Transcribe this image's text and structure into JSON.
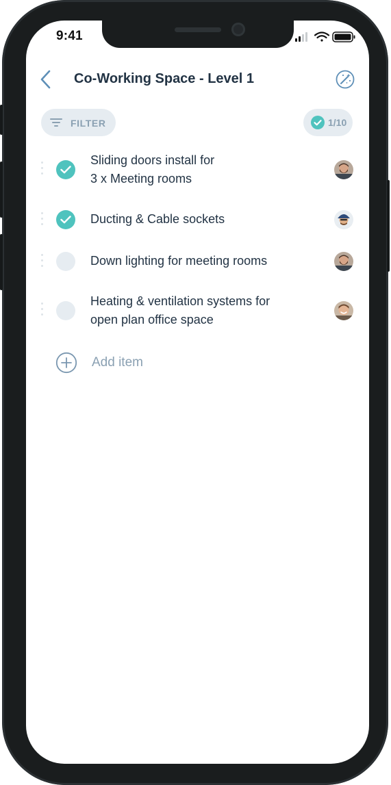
{
  "status_bar": {
    "time": "9:41"
  },
  "header": {
    "back_icon": "chevron-left-icon",
    "title": "Co-Working Space - Level 1",
    "action_icon": "magic-wand-icon"
  },
  "toolbar": {
    "filter_label": "FILTER",
    "filter_icon": "filter-lines-icon",
    "progress_label": "1/10",
    "progress_icon": "check-circle-icon"
  },
  "tasks": [
    {
      "text": "Sliding doors install for\n3 x Meeting rooms",
      "completed": true,
      "assignee_icon": "avatar-bearded-man"
    },
    {
      "text": "Ducting & Cable sockets",
      "completed": true,
      "assignee_icon": "avatar-man-cap"
    },
    {
      "text": "Down lighting for meeting rooms",
      "completed": false,
      "assignee_icon": "avatar-bearded-man"
    },
    {
      "text": "Heating & ventilation systems for\nopen plan office space",
      "completed": false,
      "assignee_icon": "avatar-smiling-man"
    }
  ],
  "add_item": {
    "label": "Add item",
    "icon": "plus-circle-icon"
  },
  "colors": {
    "accent_teal": "#4fc3be",
    "title_text": "#223344",
    "muted_text": "#8aa0b2",
    "pill_bg": "#e6ecf1",
    "device_frame": "#1a1d1e"
  }
}
